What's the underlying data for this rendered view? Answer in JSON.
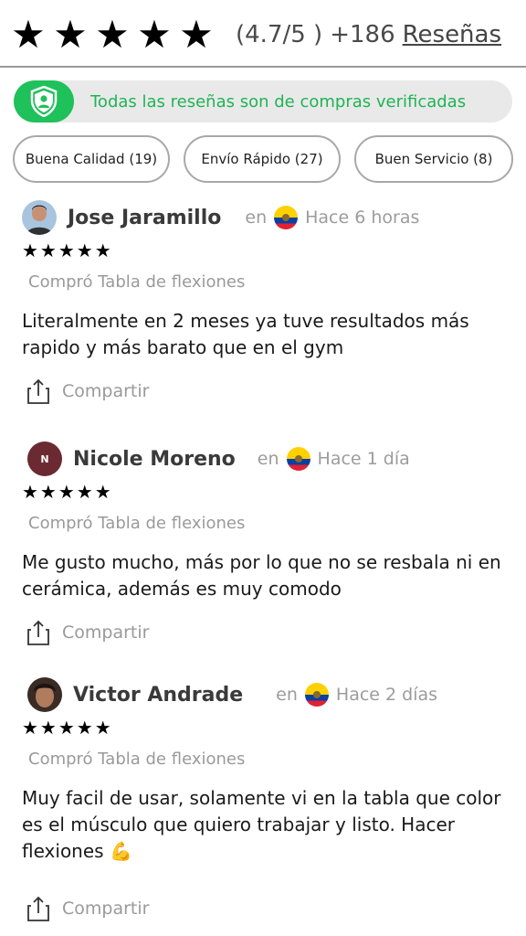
{
  "summary": {
    "stars": "★★★★★",
    "rating": "(4.7/5 )",
    "count": "+186",
    "reviews_link": "Reseñas"
  },
  "verified_banner": {
    "text": "Todas las reseñas son de compras verificadas",
    "icon": "shield-user-icon",
    "accent": "#1fc15a"
  },
  "filters": [
    {
      "label": "Buena Calidad (19)"
    },
    {
      "label": "Envío Rápido (27)"
    },
    {
      "label": "Buen Servicio (8)"
    }
  ],
  "reviews": [
    {
      "name": "Jose Jaramillo",
      "avatar": "photo",
      "location_prefix": "en",
      "country_flag": "ecuador-flag-icon",
      "time": "Hace 6 horas",
      "stars": "★★★★★",
      "product": "Compró Tabla de flexiones",
      "text": "Literalmente en 2 meses ya tuve resultados más rapido y más barato que en el gym",
      "share_label": "Compartir"
    },
    {
      "name": "Nicole Moreno",
      "avatar_initial": "N",
      "location_prefix": "en",
      "country_flag": "ecuador-flag-icon",
      "time": "Hace 1 día",
      "stars": "★★★★★",
      "product": "Compró Tabla de flexiones",
      "text": "Me gusto mucho, más por lo que no se resbala ni en cerámica, además es muy comodo",
      "share_label": "Compartir"
    },
    {
      "name": "Victor Andrade",
      "avatar": "photo",
      "location_prefix": "en",
      "country_flag": "ecuador-flag-icon",
      "time": "Hace 2 días",
      "stars": "★★★★★",
      "product": "Compró Tabla de flexiones",
      "text": "Muy facil de usar, solamente vi en la tabla que color es el músculo que quiero trabajar y listo. Hacer flexiones 💪",
      "share_label": "Compartir"
    }
  ]
}
